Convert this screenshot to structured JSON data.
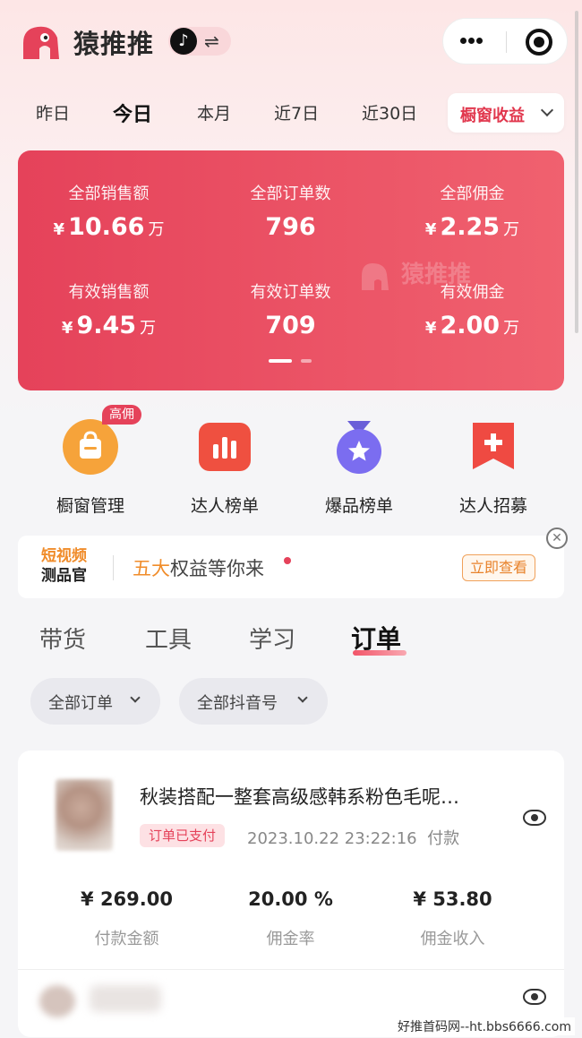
{
  "header": {
    "app_name": "猿推推",
    "platform": "抖音"
  },
  "date_tabs": [
    "昨日",
    "今日",
    "本月",
    "近7日",
    "近30日"
  ],
  "earnings_dropdown": "橱窗收益",
  "stats": {
    "watermark": "猿推推",
    "items": [
      {
        "label": "全部销售额",
        "currency": "¥",
        "value": "10.66",
        "unit": "万"
      },
      {
        "label": "全部订单数",
        "currency": "",
        "value": "796",
        "unit": ""
      },
      {
        "label": "全部佣金",
        "currency": "¥",
        "value": "2.25",
        "unit": "万"
      },
      {
        "label": "有效销售额",
        "currency": "¥",
        "value": "9.45",
        "unit": "万"
      },
      {
        "label": "有效订单数",
        "currency": "",
        "value": "709",
        "unit": ""
      },
      {
        "label": "有效佣金",
        "currency": "¥",
        "value": "2.00",
        "unit": "万"
      }
    ]
  },
  "quick_actions": [
    {
      "label": "橱窗管理",
      "badge": "高佣"
    },
    {
      "label": "达人榜单"
    },
    {
      "label": "爆品榜单"
    },
    {
      "label": "达人招募"
    }
  ],
  "banner": {
    "brand_line1": "短视频",
    "brand_line2": "测品官",
    "highlight": "五大",
    "text": "权益等你来",
    "button": "立即查看"
  },
  "main_tabs": [
    "带货",
    "工具",
    "学习",
    "订单"
  ],
  "filters": {
    "orders": "全部订单",
    "accounts": "全部抖音号"
  },
  "order": {
    "title": "秋装搭配一整套高级感韩系粉色毛呢…",
    "status": "订单已支付",
    "time": "2023.10.22 23:22:16",
    "time_suffix": "付款",
    "metrics": [
      {
        "value": "¥ 269.00",
        "label": "付款金额"
      },
      {
        "value": "20.00 %",
        "label": "佣金率"
      },
      {
        "value": "¥ 53.80",
        "label": "佣金收入"
      }
    ]
  },
  "footer_watermark": "好推首码网--ht.bbs6666.com",
  "colors": {
    "accent": "#e5425a",
    "orange": "#f08c2a"
  }
}
